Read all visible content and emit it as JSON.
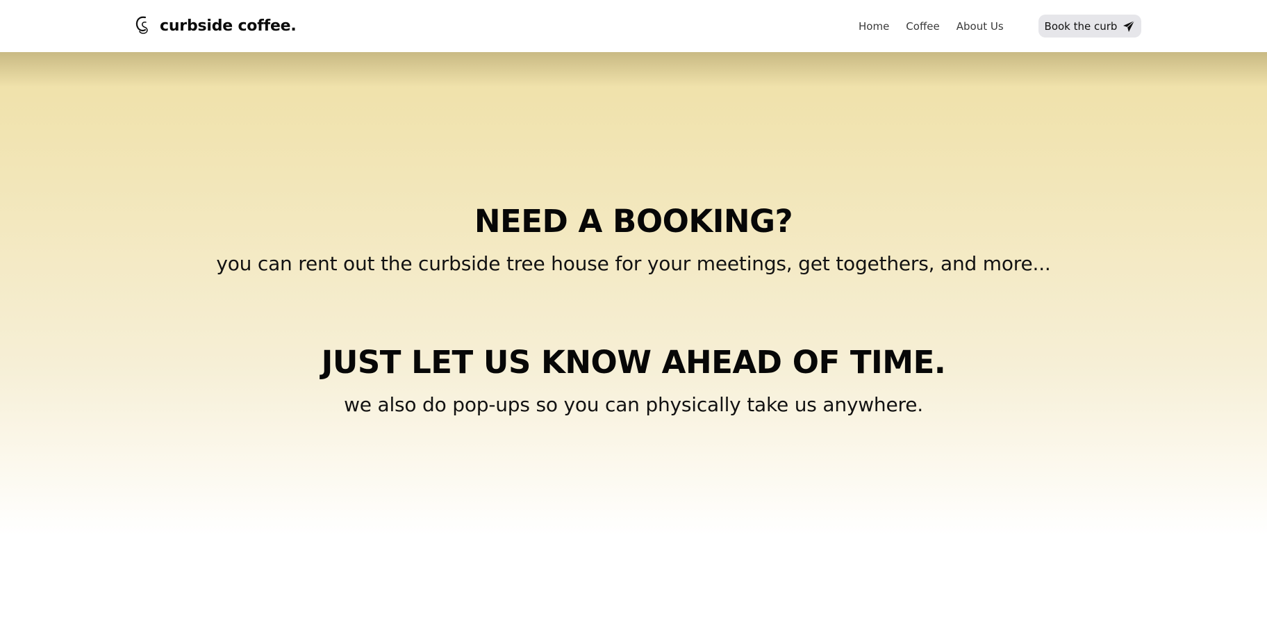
{
  "brand": {
    "name": "curbside coffee.",
    "logo_icon": "cs-monogram-logo"
  },
  "nav": {
    "links": [
      {
        "label": "Home"
      },
      {
        "label": "Coffee"
      },
      {
        "label": "About Us"
      }
    ],
    "cta": {
      "label": "Book the curb",
      "icon": "paper-plane-icon"
    }
  },
  "hero": {
    "sections": [
      {
        "heading": "NEED A BOOKING?",
        "text": "you can rent out the curbside tree house for your meetings, get togethers, and more..."
      },
      {
        "heading": "JUST LET US KNOW AHEAD OF TIME.",
        "text": "we also do pop-ups so you can physically take us anywhere."
      }
    ]
  },
  "colors": {
    "gradient_top": "#efe0a6",
    "gradient_bottom": "#ffffff",
    "cta_background": "#e6e6ea",
    "text": "#0b0b0b"
  }
}
